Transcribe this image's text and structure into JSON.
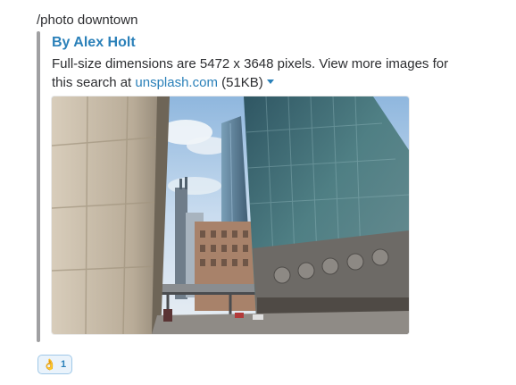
{
  "message": {
    "command_text": "/photo downtown"
  },
  "attachment": {
    "author_label": "By Alex Holt",
    "description_prefix": "Full-size dimensions are 5472 x 3648 pixels. View more images for this search at ",
    "link_text": "unsplash.com",
    "size_text": " (51KB)",
    "dropdown_icon": "caret-down-icon",
    "image_subject": "photo-downtown-buildings",
    "colors": {
      "link": "#2a80b9",
      "bar": "#a0a0a2"
    }
  },
  "reactions": [
    {
      "emoji": "👌",
      "emoji_icon": "ok-hand-icon",
      "count": "1"
    }
  ]
}
